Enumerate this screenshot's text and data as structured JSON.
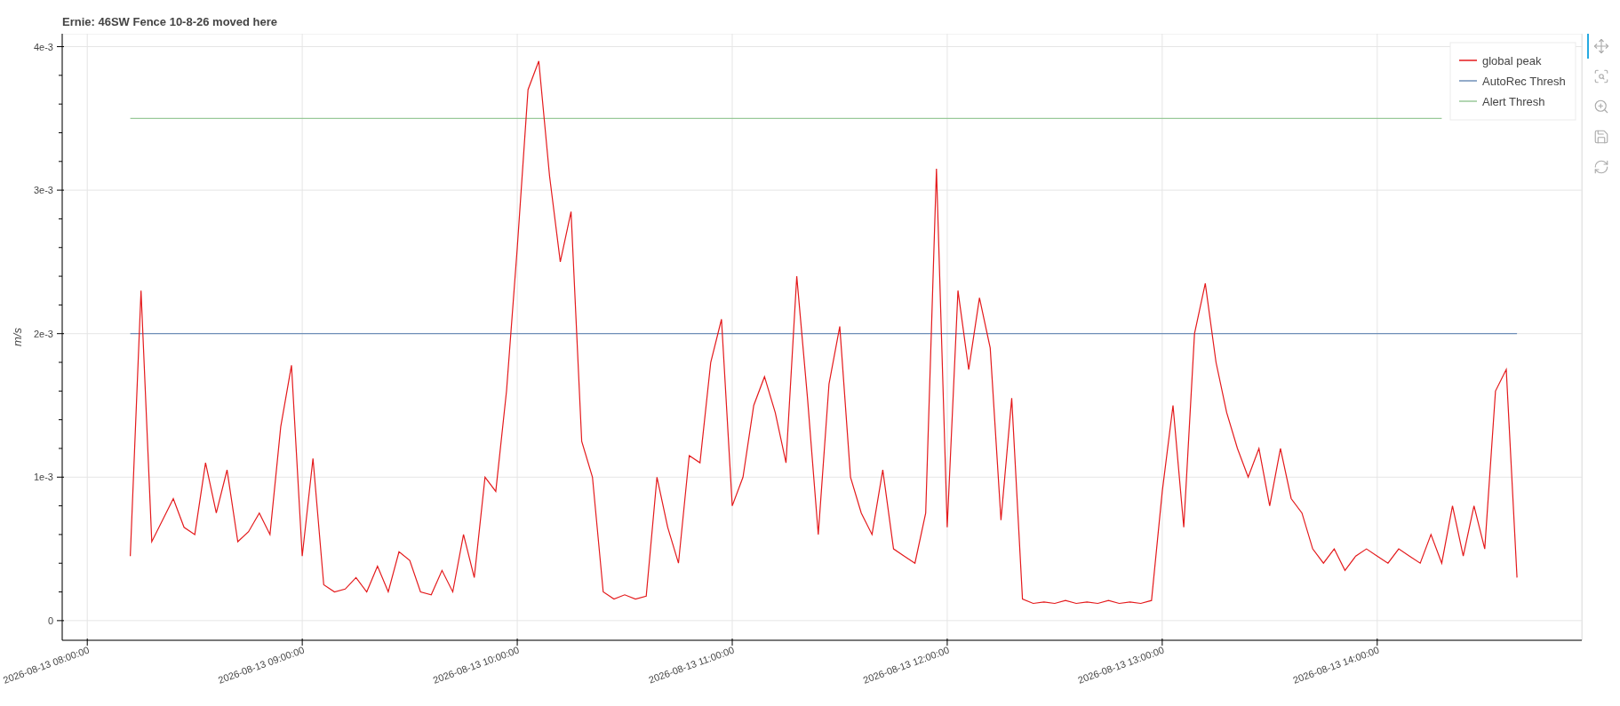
{
  "title": "Ernie: 46SW Fence 10-8-26 moved here",
  "toolbar": [
    {
      "kind": "pan",
      "selected": true
    },
    {
      "kind": "box_zoom",
      "selected": false
    },
    {
      "kind": "wheel_zoom",
      "selected": false
    },
    {
      "kind": "save",
      "selected": false
    },
    {
      "kind": "reset",
      "selected": false
    }
  ],
  "chart_data": {
    "type": "line",
    "ylabel": "m/s",
    "grid": true,
    "legend": true,
    "ylim": [
      -0.000137,
      0.00409
    ],
    "yticks": [
      {
        "value": 0,
        "label": "0"
      },
      {
        "value": 0.001,
        "label": "1e-3"
      },
      {
        "value": 0.002,
        "label": "2e-3"
      },
      {
        "value": 0.003,
        "label": "3e-3"
      },
      {
        "value": 0.004,
        "label": "4e-3"
      }
    ],
    "categories": [
      "2026-08-13 08:00:00",
      null,
      null,
      null,
      null,
      null,
      null,
      null,
      null,
      null,
      null,
      null,
      null,
      null,
      null,
      null,
      null,
      null,
      null,
      null,
      "2026-08-13 09:00:00",
      null,
      null,
      null,
      null,
      null,
      null,
      null,
      null,
      null,
      null,
      null,
      null,
      null,
      null,
      null,
      null,
      null,
      null,
      null,
      "2026-08-13 10:00:00",
      null,
      null,
      null,
      null,
      null,
      null,
      null,
      null,
      null,
      null,
      null,
      null,
      null,
      null,
      null,
      null,
      null,
      null,
      null,
      "2026-08-13 11:00:00",
      null,
      null,
      null,
      null,
      null,
      null,
      null,
      null,
      null,
      null,
      null,
      null,
      null,
      null,
      null,
      null,
      null,
      null,
      null,
      "2026-08-13 12:00:00",
      null,
      null,
      null,
      null,
      null,
      null,
      null,
      null,
      null,
      null,
      null,
      null,
      null,
      null,
      null,
      null,
      null,
      null,
      null,
      "2026-08-13 13:00:00",
      null,
      null,
      null,
      null,
      null,
      null,
      null,
      null,
      null,
      null,
      null,
      null,
      null,
      null,
      null,
      null,
      null,
      null,
      null,
      "2026-08-13 14:00:00",
      null,
      null,
      null,
      null,
      null,
      null,
      null,
      null,
      null,
      null,
      null,
      null,
      null
    ],
    "series": [
      {
        "name": "global peak",
        "color": "#e41a1c",
        "values": [
          null,
          null,
          null,
          null,
          0.00045,
          0.0023,
          0.00055,
          0.0007,
          0.00085,
          0.00065,
          0.0006,
          0.0011,
          0.00075,
          0.00105,
          0.00055,
          0.00062,
          0.00075,
          0.0006,
          0.00135,
          0.00178,
          0.00045,
          0.00113,
          0.00025,
          0.0002,
          0.00022,
          0.0003,
          0.0002,
          0.00038,
          0.0002,
          0.00048,
          0.00042,
          0.0002,
          0.00018,
          0.00035,
          0.0002,
          0.0006,
          0.0003,
          0.001,
          0.0009,
          0.0016,
          0.0026,
          0.0037,
          0.0039,
          0.0031,
          0.0025,
          0.00285,
          0.00125,
          0.001,
          0.0002,
          0.00015,
          0.00018,
          0.00015,
          0.00017,
          0.001,
          0.00065,
          0.0004,
          0.00115,
          0.0011,
          0.0018,
          0.0021,
          0.0008,
          0.001,
          0.0015,
          0.0017,
          0.00145,
          0.0011,
          0.0024,
          0.00155,
          0.0006,
          0.00165,
          0.00205,
          0.001,
          0.00075,
          0.0006,
          0.00105,
          0.0005,
          0.00045,
          0.0004,
          0.00075,
          0.00315,
          0.00065,
          0.0023,
          0.00175,
          0.00225,
          0.0019,
          0.0007,
          0.00155,
          0.00015,
          0.00012,
          0.00013,
          0.00012,
          0.00014,
          0.00012,
          0.00013,
          0.00012,
          0.00014,
          0.00012,
          0.00013,
          0.00012,
          0.00014,
          0.0009,
          0.0015,
          0.00065,
          0.002,
          0.00235,
          0.0018,
          0.00145,
          0.0012,
          0.001,
          0.0012,
          0.0008,
          0.0012,
          0.00085,
          0.00075,
          0.0005,
          0.0004,
          0.0005,
          0.00035,
          0.00045,
          0.0005,
          0.00045,
          0.0004,
          0.0005,
          0.00045,
          0.0004,
          0.0006,
          0.0004,
          0.0008,
          0.00045,
          0.0008,
          0.0005,
          0.0016,
          0.00175,
          0.0003
        ]
      },
      {
        "name": "AutoRec Thresh",
        "color": "#6f8fb8",
        "values": [
          null,
          null,
          null,
          null,
          0.002,
          0.002,
          0.002,
          0.002,
          0.002,
          0.002,
          0.002,
          0.002,
          0.002,
          0.002,
          0.002,
          0.002,
          0.002,
          0.002,
          0.002,
          0.002,
          0.002,
          0.002,
          0.002,
          0.002,
          0.002,
          0.002,
          0.002,
          0.002,
          0.002,
          0.002,
          0.002,
          0.002,
          0.002,
          0.002,
          0.002,
          0.002,
          0.002,
          0.002,
          0.002,
          0.002,
          0.002,
          0.002,
          0.002,
          0.002,
          0.002,
          0.002,
          0.002,
          0.002,
          0.002,
          0.002,
          0.002,
          0.002,
          0.002,
          0.002,
          0.002,
          0.002,
          0.002,
          0.002,
          0.002,
          0.002,
          0.002,
          0.002,
          0.002,
          0.002,
          0.002,
          0.002,
          0.002,
          0.002,
          0.002,
          0.002,
          0.002,
          0.002,
          0.002,
          0.002,
          0.002,
          0.002,
          0.002,
          0.002,
          0.002,
          0.002,
          0.002,
          0.002,
          0.002,
          0.002,
          0.002,
          0.002,
          0.002,
          0.002,
          0.002,
          0.002,
          0.002,
          0.002,
          0.002,
          0.002,
          0.002,
          0.002,
          0.002,
          0.002,
          0.002,
          0.002,
          0.002,
          0.002,
          0.002,
          0.002,
          0.002,
          0.002,
          0.002,
          0.002,
          0.002,
          0.002,
          0.002,
          0.002,
          0.002,
          0.002,
          0.002,
          0.002,
          0.002,
          0.002,
          0.002,
          0.002,
          0.002,
          0.002,
          0.002,
          0.002,
          0.002,
          0.002,
          0.002,
          0.002,
          0.002,
          0.002,
          0.002,
          0.002,
          0.002,
          0.002
        ]
      },
      {
        "name": "Alert Thresh",
        "color": "#99c999",
        "values": [
          null,
          null,
          null,
          null,
          0.0035,
          0.0035,
          0.0035,
          0.0035,
          0.0035,
          0.0035,
          0.0035,
          0.0035,
          0.0035,
          0.0035,
          0.0035,
          0.0035,
          0.0035,
          0.0035,
          0.0035,
          0.0035,
          0.0035,
          0.0035,
          0.0035,
          0.0035,
          0.0035,
          0.0035,
          0.0035,
          0.0035,
          0.0035,
          0.0035,
          0.0035,
          0.0035,
          0.0035,
          0.0035,
          0.0035,
          0.0035,
          0.0035,
          0.0035,
          0.0035,
          0.0035,
          0.0035,
          0.0035,
          0.0035,
          0.0035,
          0.0035,
          0.0035,
          0.0035,
          0.0035,
          0.0035,
          0.0035,
          0.0035,
          0.0035,
          0.0035,
          0.0035,
          0.0035,
          0.0035,
          0.0035,
          0.0035,
          0.0035,
          0.0035,
          0.0035,
          0.0035,
          0.0035,
          0.0035,
          0.0035,
          0.0035,
          0.0035,
          0.0035,
          0.0035,
          0.0035,
          0.0035,
          0.0035,
          0.0035,
          0.0035,
          0.0035,
          0.0035,
          0.0035,
          0.0035,
          0.0035,
          0.0035,
          0.0035,
          0.0035,
          0.0035,
          0.0035,
          0.0035,
          0.0035,
          0.0035,
          0.0035,
          0.0035,
          0.0035,
          0.0035,
          0.0035,
          0.0035,
          0.0035,
          0.0035,
          0.0035,
          0.0035,
          0.0035,
          0.0035,
          0.0035,
          0.0035,
          0.0035,
          0.0035,
          0.0035,
          0.0035,
          0.0035,
          0.0035,
          0.0035,
          0.0035,
          0.0035,
          0.0035,
          0.0035,
          0.0035,
          0.0035,
          0.0035,
          0.0035,
          0.0035,
          0.0035,
          0.0035,
          0.0035,
          0.0035,
          0.0035,
          0.0035,
          0.0035,
          0.0035,
          0.0035,
          0.0035,
          null,
          null,
          null,
          null,
          null,
          null,
          null
        ]
      }
    ]
  }
}
